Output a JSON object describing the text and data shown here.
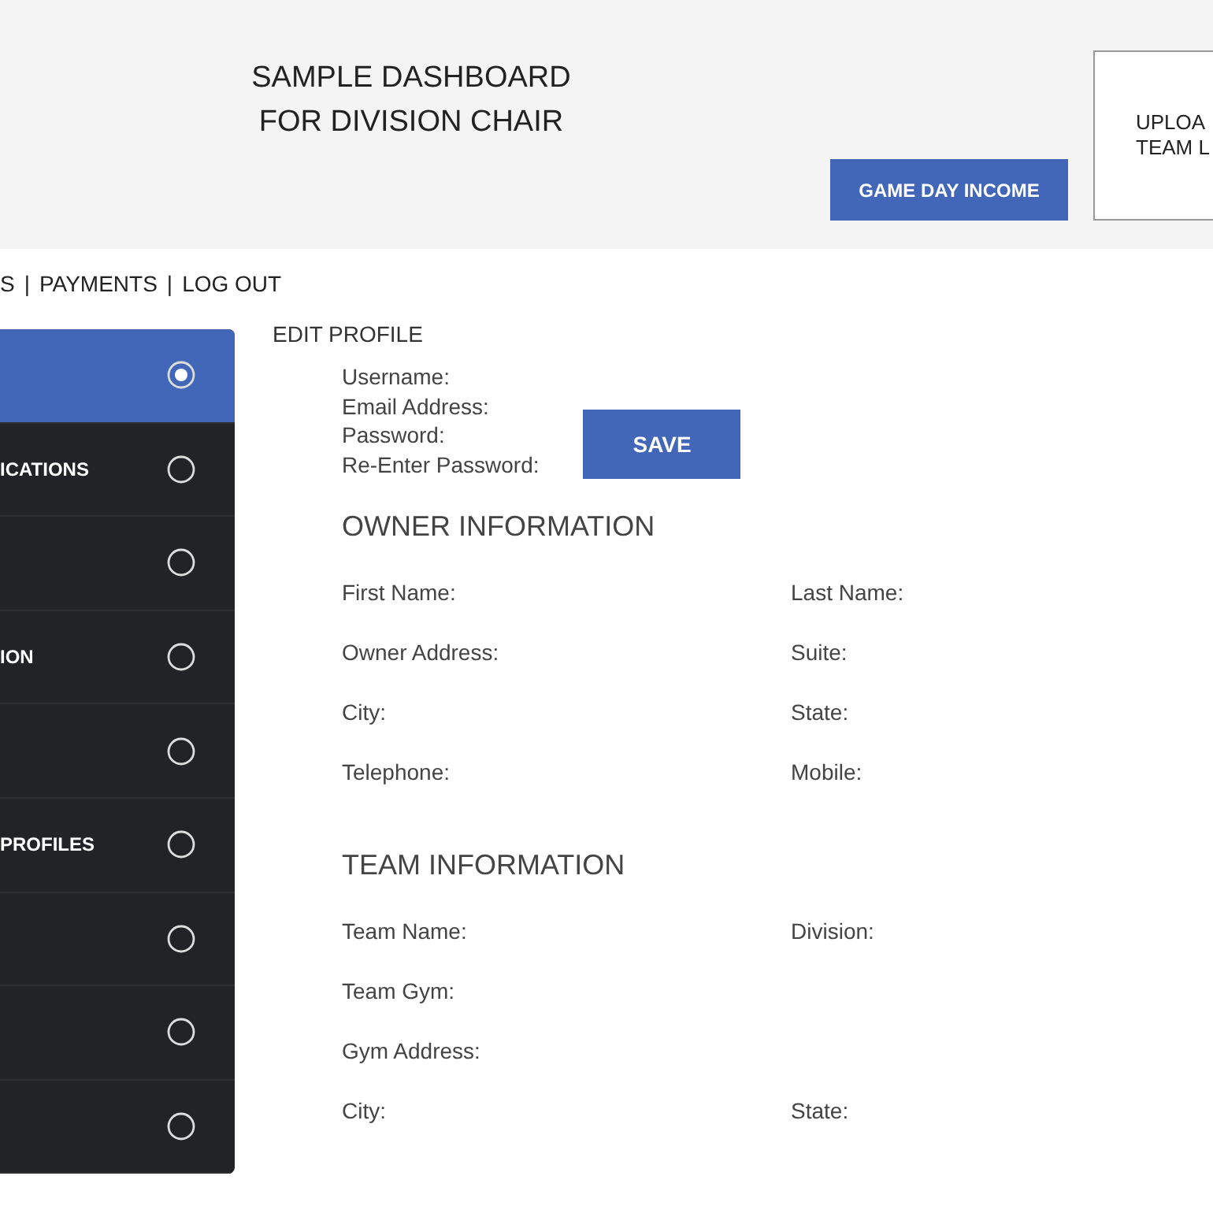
{
  "header": {
    "title_lines": [
      "SAMPLE DASHBOARD",
      "FOR DIVISION CHAIR"
    ],
    "income_button": "GAME DAY INCOME",
    "upload_lines": [
      "UPLOA",
      "TEAM L"
    ]
  },
  "nav": {
    "separator": "|",
    "links": [
      "S",
      "PAYMENTS",
      "LOG OUT"
    ]
  },
  "sidebar": {
    "items": [
      {
        "selected": true
      },
      {
        "label": "ICATIONS",
        "selected": false
      },
      {
        "selected": false
      },
      {
        "label": "ION",
        "selected": false
      },
      {
        "selected": false
      },
      {
        "label": "PROFILES",
        "selected": false
      },
      {
        "selected": false
      },
      {
        "selected": false
      },
      {
        "selected": false
      }
    ]
  },
  "edit_profile": {
    "title": "EDIT PROFILE",
    "fields": [
      "Username:",
      "Email Address:",
      "Password:",
      "Re-Enter Password:"
    ],
    "save_button": "SAVE"
  },
  "sections": [
    {
      "title": "OWNER INFORMATION",
      "rows": [
        {
          "left": "First Name:",
          "right": "Last Name:"
        },
        {
          "left": "Owner Address:",
          "right": "Suite:"
        },
        {
          "left": "City:",
          "right": "State:"
        },
        {
          "left": "Telephone:",
          "right": "Mobile:"
        }
      ]
    },
    {
      "title": "TEAM INFORMATION",
      "rows": [
        {
          "left": "Team Name:",
          "right": "Division:"
        },
        {
          "left": "Team Gym:"
        },
        {
          "left": "Gym Address:"
        },
        {
          "left": "City:",
          "right": "State:"
        }
      ]
    }
  ]
}
